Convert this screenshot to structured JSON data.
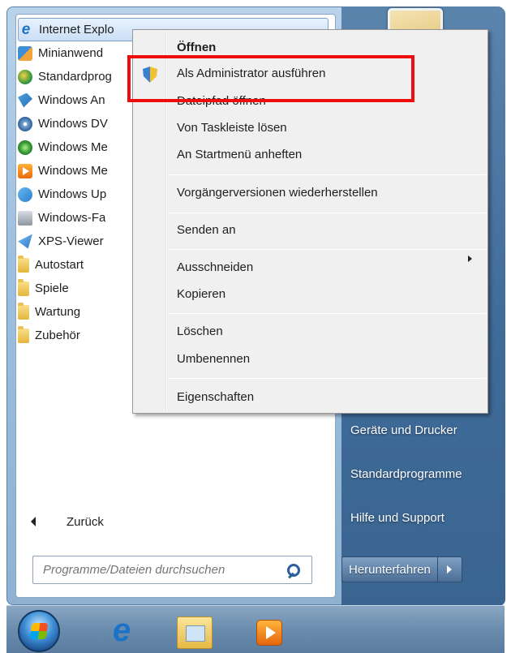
{
  "programs": [
    {
      "label": "Internet Explo",
      "icon": "internet-explorer-icon"
    },
    {
      "label": "Minianwend",
      "icon": "gadgets-icon"
    },
    {
      "label": "Standardprog",
      "icon": "default-programs-icon"
    },
    {
      "label": "Windows An",
      "icon": "windows-anytime-icon"
    },
    {
      "label": "Windows DV",
      "icon": "dvd-maker-icon"
    },
    {
      "label": "Windows Me",
      "icon": "media-center-icon"
    },
    {
      "label": "Windows Me",
      "icon": "media-player-icon"
    },
    {
      "label": "Windows Up",
      "icon": "windows-update-icon"
    },
    {
      "label": "Windows-Fa",
      "icon": "fax-icon"
    },
    {
      "label": "XPS-Viewer",
      "icon": "xps-viewer-icon"
    },
    {
      "label": "Autostart",
      "icon": "folder-icon"
    },
    {
      "label": "Spiele",
      "icon": "folder-icon"
    },
    {
      "label": "Wartung",
      "icon": "folder-icon"
    },
    {
      "label": "Zubehör",
      "icon": "folder-icon"
    }
  ],
  "back": {
    "label": "Zurück"
  },
  "search": {
    "placeholder": "Programme/Dateien durchsuchen"
  },
  "right_links": {
    "devices": "Geräte und Drucker",
    "defaults": "Standardprogramme",
    "help": "Hilfe und Support"
  },
  "shutdown": {
    "label": "Herunterfahren"
  },
  "context_menu": {
    "open": "Öffnen",
    "run_as_admin": "Als Administrator ausführen",
    "open_file_location": "Dateipfad öffnen",
    "unpin_taskbar": "Von Taskleiste lösen",
    "pin_start": "An Startmenü anheften",
    "restore_versions": "Vorgängerversionen wiederherstellen",
    "send_to": "Senden an",
    "cut": "Ausschneiden",
    "copy": "Kopieren",
    "delete": "Löschen",
    "rename": "Umbenennen",
    "properties": "Eigenschaften"
  },
  "colors": {
    "highlight_box": "#ee0d0d",
    "start_menu_right": "#3f6b98",
    "taskbar": "#6a8cad"
  }
}
